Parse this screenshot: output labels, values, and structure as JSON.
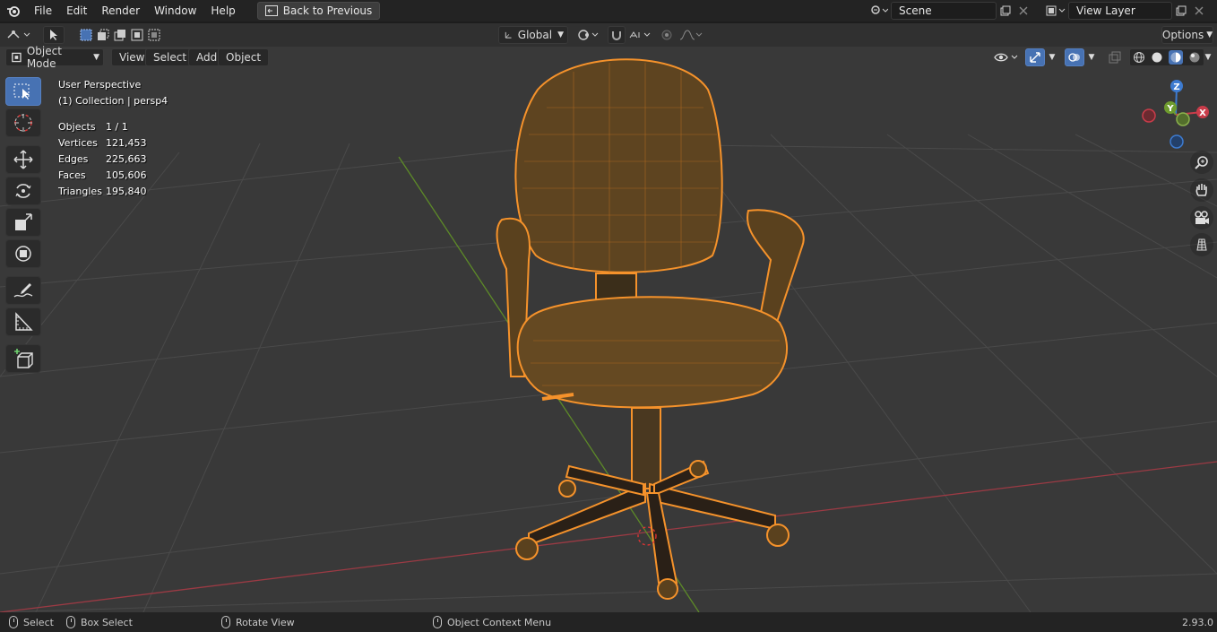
{
  "topbar": {
    "menus": [
      "File",
      "Edit",
      "Render",
      "Window",
      "Help"
    ],
    "back_button": "Back to Previous",
    "scene_name": "Scene",
    "view_layer_name": "View Layer"
  },
  "header": {
    "transform_orientation": "Global",
    "options_label": "Options",
    "mode": "Object Mode",
    "menus": [
      "View",
      "Select",
      "Add",
      "Object"
    ]
  },
  "viewport": {
    "perspective_label": "User Perspective",
    "collection_label": "(1) Collection | persp4",
    "stats": [
      {
        "key": "Objects",
        "value": "1 / 1"
      },
      {
        "key": "Vertices",
        "value": "121,453"
      },
      {
        "key": "Edges",
        "value": "225,663"
      },
      {
        "key": "Faces",
        "value": "105,606"
      },
      {
        "key": "Triangles",
        "value": "195,840"
      }
    ],
    "gizmo_axes": {
      "x": "X",
      "y": "Y",
      "z": "Z"
    },
    "colors": {
      "background": "#393939",
      "selection": "#f5922b",
      "x_axis": "#c93c4a",
      "y_axis": "#6e9b2e",
      "z_axis": "#3d7bd0",
      "active_tool": "#4772b3"
    }
  },
  "toolbar": {
    "tools": [
      "select-box-icon",
      "cursor-icon",
      "move-icon",
      "rotate-icon",
      "scale-icon",
      "transform-icon",
      "annotate-icon",
      "measure-icon",
      "add-cube-icon"
    ]
  },
  "statusbar": {
    "select": "Select",
    "box_select": "Box Select",
    "rotate_view": "Rotate View",
    "context_menu": "Object Context Menu",
    "version": "2.93.0"
  }
}
